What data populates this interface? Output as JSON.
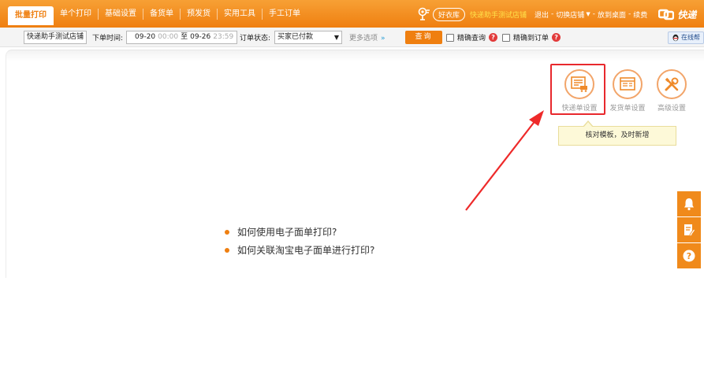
{
  "topbar": {
    "tabs": [
      {
        "label": "批量打印"
      },
      {
        "label": "单个打印"
      },
      {
        "label": "基础设置"
      },
      {
        "label": "备货单"
      },
      {
        "label": "预发货"
      },
      {
        "label": "实用工具"
      },
      {
        "label": "手工订单"
      }
    ],
    "brand_label": "好衣库",
    "shop_name": "快递助手测试店铺",
    "logout": "退出",
    "switch_shop": "切换店铺",
    "desktop": "放到桌面",
    "renew": "续费",
    "product_name": "快递"
  },
  "filters": {
    "shop_value": "快递助手测试店铺",
    "order_time_label": "下单时间:",
    "date_from": "09-20",
    "time_from": "00:00",
    "to_label": "至",
    "date_to": "09-26",
    "time_to": "23:59",
    "status_label": "订单状态:",
    "status_value": "买家已付款",
    "more_options": "更多选项",
    "more_chevron": "»",
    "query_button": "查询",
    "precise_query": "精确查询",
    "precise_order": "精确到订单",
    "online_help": "在线帮"
  },
  "settings": [
    {
      "label": "快递单设置",
      "icon": "express-waybill-icon"
    },
    {
      "label": "发货单设置",
      "icon": "invoice-icon"
    },
    {
      "label": "高级设置",
      "icon": "tools-icon"
    }
  ],
  "tooltip": "核对模板，及时新增",
  "help_links": [
    "如何使用电子面单打印?",
    "如何关联淘宝电子面单进行打印?"
  ],
  "side_tools": [
    "bell-icon",
    "edit-note-icon",
    "question-icon"
  ],
  "colors": {
    "accent": "#ef7f10",
    "highlight": "#e8282d",
    "brand_yellow": "#ffe14a"
  }
}
